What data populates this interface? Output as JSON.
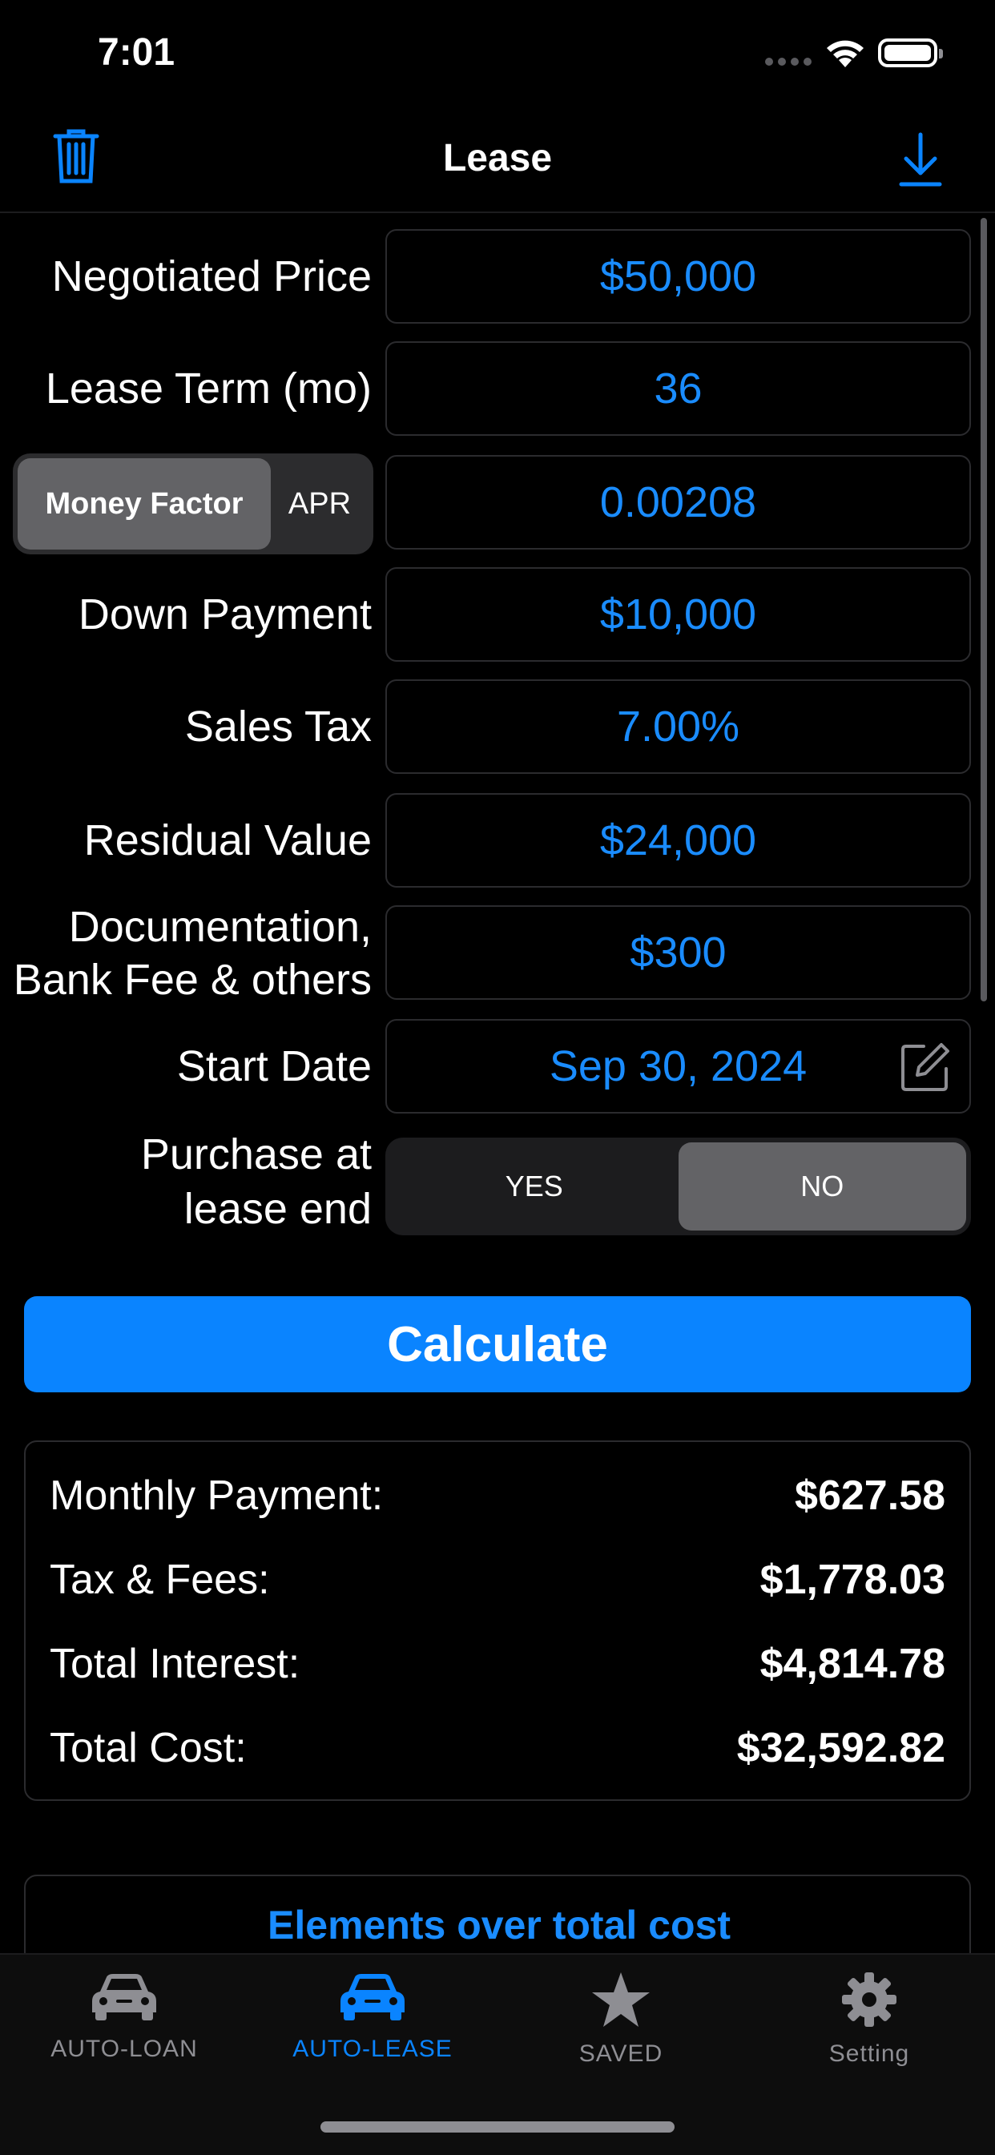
{
  "status": {
    "time": "7:01"
  },
  "nav": {
    "title": "Lease",
    "left_icon": "trash-icon",
    "right_icon": "download-icon"
  },
  "colors": {
    "accent": "#0a84ff",
    "field_text": "#1a8cff",
    "background": "#000000"
  },
  "form": {
    "negotiated_price": {
      "label": "Negotiated Price",
      "value": "$50,000"
    },
    "lease_term": {
      "label": "Lease Term (mo)",
      "value": "36"
    },
    "rate_mode": {
      "options": [
        "Money Factor",
        "APR"
      ],
      "selected": "Money Factor",
      "value": "0.00208"
    },
    "down_payment": {
      "label": "Down Payment",
      "value": "$10,000"
    },
    "sales_tax": {
      "label": "Sales Tax",
      "value": "7.00%"
    },
    "residual_value": {
      "label": "Residual Value",
      "value": "$24,000"
    },
    "doc_fees": {
      "label_line1": "Documentation,",
      "label_line2": "Bank Fee & others",
      "value": "$300"
    },
    "start_date": {
      "label": "Start Date",
      "value": "Sep 30, 2024",
      "icon": "edit-icon"
    },
    "purchase": {
      "label_line1": "Purchase at",
      "label_line2": "lease end",
      "options": [
        "YES",
        "NO"
      ],
      "selected": "NO"
    }
  },
  "calculate_label": "Calculate",
  "results": [
    {
      "label": "Monthly Payment:",
      "value": "$627.58"
    },
    {
      "label": "Tax & Fees:",
      "value": "$1,778.03"
    },
    {
      "label": "Total Interest:",
      "value": "$4,814.78"
    },
    {
      "label": "Total Cost:",
      "value": "$32,592.82"
    }
  ],
  "elements_title": "Elements over total cost",
  "tabs": [
    {
      "label": "AUTO-LOAN",
      "icon": "car-icon",
      "active": false
    },
    {
      "label": "AUTO-LEASE",
      "icon": "car-icon",
      "active": true
    },
    {
      "label": "SAVED",
      "icon": "star-icon",
      "active": false
    },
    {
      "label": "Setting",
      "icon": "gear-icon",
      "active": false
    }
  ]
}
